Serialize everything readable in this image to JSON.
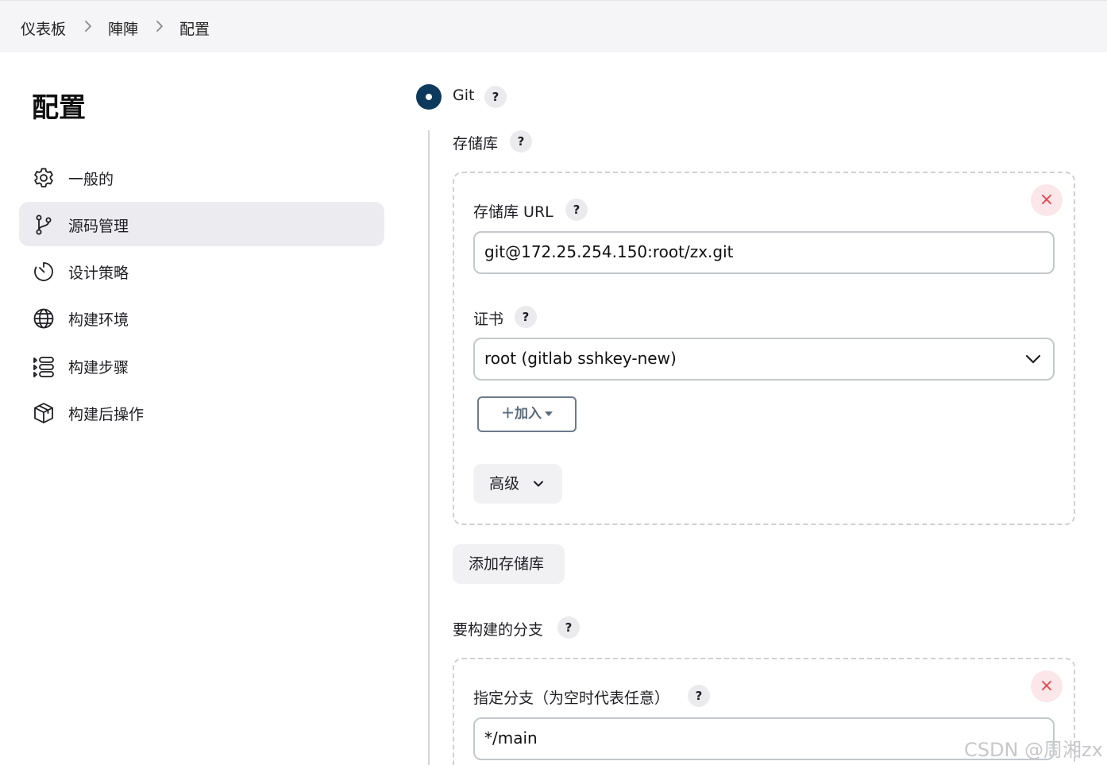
{
  "breadcrumb": {
    "items": [
      "仪表板",
      "陣陣",
      "配置"
    ]
  },
  "sidebar": {
    "title": "配置",
    "items": [
      {
        "label": "一般的",
        "icon": "gear-icon"
      },
      {
        "label": "源码管理",
        "icon": "git-branch-icon",
        "active": true
      },
      {
        "label": "设计策略",
        "icon": "timer-icon"
      },
      {
        "label": "构建环境",
        "icon": "globe-icon"
      },
      {
        "label": "构建步骤",
        "icon": "list-icon"
      },
      {
        "label": "构建后操作",
        "icon": "package-icon"
      }
    ]
  },
  "scm": {
    "option_label": "Git",
    "help": "?",
    "repositories_label": "存储库",
    "repository": {
      "url_label": "存储库 URL",
      "url_value": "git@172.25.254.150:root/zx.git",
      "credentials_label": "证书",
      "credentials_value": "root (gitlab sshkey-new)",
      "add_button": "＋加入",
      "advanced_button": "高级",
      "remove_icon": "×"
    },
    "add_repository_button": "添加存储库",
    "branches_label": "要构建的分支",
    "branch": {
      "specifier_label": "指定分支（为空时代表任意）",
      "specifier_value": "*/main",
      "remove_icon": "×"
    }
  },
  "watermark": "CSDN @周湘zx",
  "colors": {
    "radio_selected": "#0d3a5c",
    "remove_button_bg": "#fbe6e9",
    "remove_button_fg": "#e5484d",
    "active_nav_bg": "#ececf0"
  }
}
